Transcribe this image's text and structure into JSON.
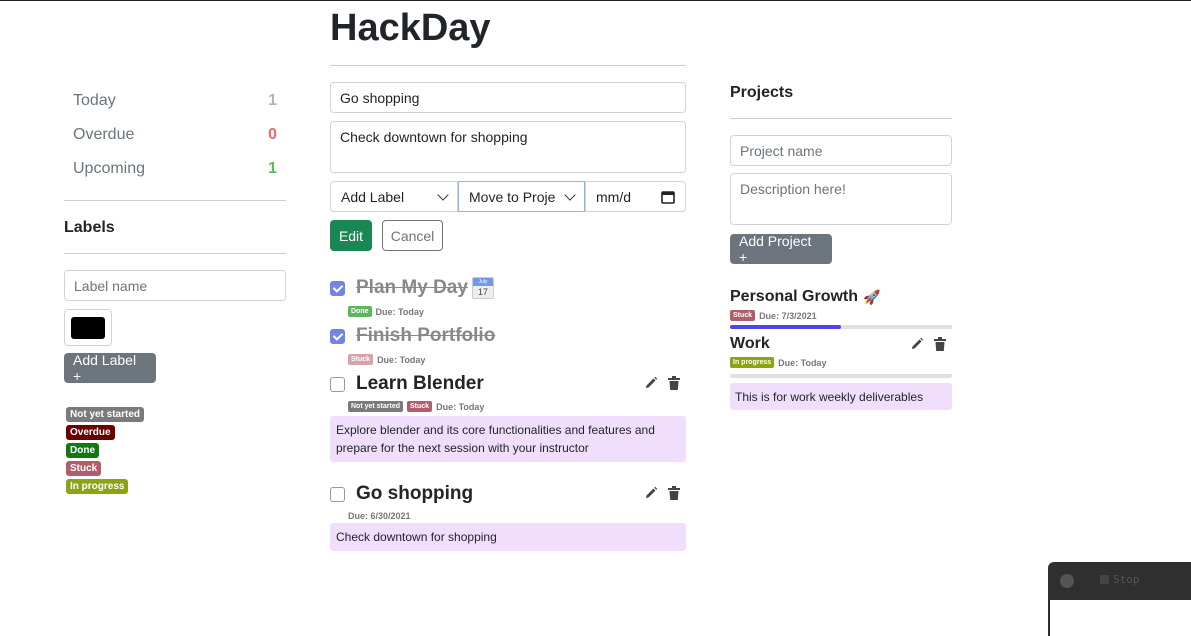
{
  "app": {
    "title": "HackDay"
  },
  "sidebar": {
    "nav": [
      {
        "label": "Today",
        "count": "1",
        "color": "#adb5bd"
      },
      {
        "label": "Overdue",
        "count": "0",
        "color": "#e46a6a"
      },
      {
        "label": "Upcoming",
        "count": "1",
        "color": "#5cb85c"
      }
    ],
    "labels_title": "Labels",
    "label_name_placeholder": "Label name",
    "color_value": "#000000",
    "add_label": "Add Label +",
    "labels": [
      {
        "name": "Not yet started",
        "color": "#7a7a7a"
      },
      {
        "name": "Overdue",
        "color": "#6b0000"
      },
      {
        "name": "Done",
        "color": "#107a10"
      },
      {
        "name": "Stuck",
        "color": "#b15e6a"
      },
      {
        "name": "In progress",
        "color": "#8aa412"
      }
    ]
  },
  "editor": {
    "title_value": "Go shopping",
    "desc_value": "Check downtown for shopping",
    "add_label_select": "Add Label",
    "project_select": "Move to Proje",
    "date_placeholder": "mm/d",
    "edit_btn": "Edit",
    "cancel_btn": "Cancel"
  },
  "tasks": [
    {
      "title": "Plan My Day",
      "checked": true,
      "badges": [
        {
          "text": "Done",
          "color": "#5cb85c"
        }
      ],
      "due": "Due: Today",
      "calendar_month": "July",
      "calendar_day": "17"
    },
    {
      "title": "Finish Portfolio",
      "checked": true,
      "badges": [
        {
          "text": "Stuck",
          "color": "#d4a4aa"
        }
      ],
      "due": "Due: Today"
    },
    {
      "title": "Learn Blender",
      "checked": false,
      "badges": [
        {
          "text": "Not yet started",
          "color": "#7a7a7a"
        },
        {
          "text": "Stuck",
          "color": "#b15e6a"
        }
      ],
      "due": "Due: Today",
      "desc": "Explore blender and its core functionalities and features and prepare for the next session with your instructor"
    },
    {
      "title": "Go shopping",
      "checked": false,
      "badges": [],
      "due": "Due: 6/30/2021",
      "desc": "Check downtown for shopping"
    }
  ],
  "projects": {
    "title": "Projects",
    "name_placeholder": "Project name",
    "desc_placeholder": "Description here!",
    "add_btn": "Add Project +",
    "items": [
      {
        "name": "Personal Growth",
        "emoji": "🚀",
        "badge": "Stuck",
        "badge_color": "#b15e6a",
        "due": "Due: 7/3/2021",
        "progress": 0.5
      },
      {
        "name": "Work",
        "badge": "In progress",
        "badge_color": "#8aa412",
        "due": "Due: Today",
        "progress": 0,
        "desc": "This is for work weekly deliverables"
      }
    ]
  },
  "floating": {
    "stop_label": "Stop"
  }
}
